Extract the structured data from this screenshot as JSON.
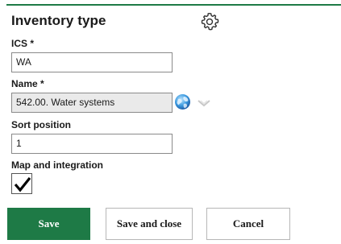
{
  "form": {
    "title": "Inventory type",
    "settings_icon": "gear-icon"
  },
  "fields": {
    "ics": {
      "label": "ICS *",
      "value": "WA"
    },
    "name": {
      "label": "Name *",
      "value": "542.00. Water systems",
      "globe_icon": "globe-icon",
      "expand_icon": "chevron-down-icon"
    },
    "sort_position": {
      "label": "Sort position",
      "value": "1"
    },
    "map_integration": {
      "label": "Map and integration",
      "checked": true
    }
  },
  "buttons": {
    "save": "Save",
    "save_and_close": "Save and close",
    "cancel": "Cancel"
  },
  "colors": {
    "accent": "#1e7a46",
    "readonly_bg": "#eaeaea",
    "border": "#8a8a8a"
  }
}
